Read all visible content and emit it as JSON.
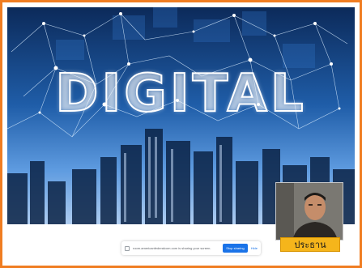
{
  "slide": {
    "title": "DIGITAL",
    "colors": {
      "sky_top": "#0c2a5a",
      "sky_bottom": "#aeccf0",
      "network_lines": "#d8ecff"
    }
  },
  "screen_share": {
    "message": "room.americanfederalcom.com is sharing your screen.",
    "stop_label": "Stop sharing",
    "hide_label": "Hide"
  },
  "participant": {
    "name": "ประธาน"
  },
  "colors": {
    "frame_border": "#f07d22",
    "name_tag": "#f5b51b",
    "accent_blue": "#1a73e8"
  }
}
